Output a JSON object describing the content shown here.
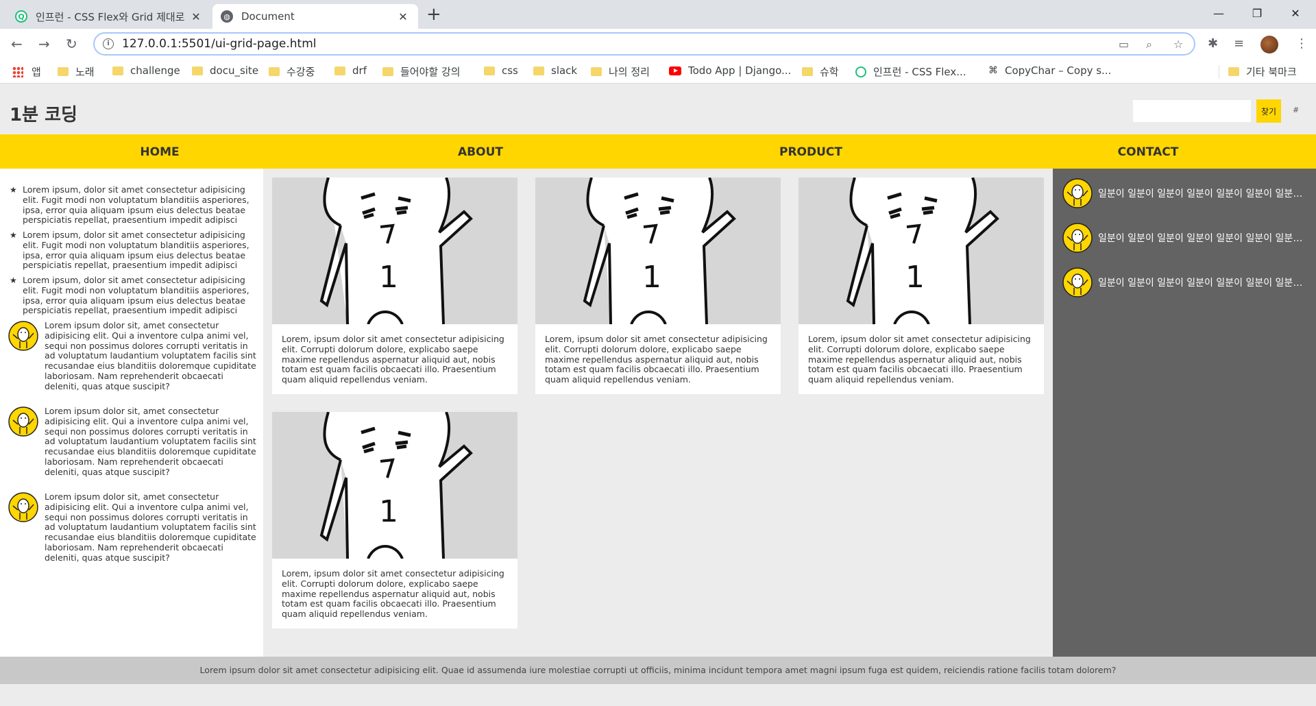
{
  "browser": {
    "tabs": [
      {
        "title": "인프런 - CSS Flex와 Grid 제대로",
        "active": false
      },
      {
        "title": "Document",
        "active": true
      }
    ],
    "url": "127.0.0.1:5501/ui-grid-page.html",
    "bookmarks": [
      "앱",
      "노래",
      "challenge",
      "docu_site",
      "수강중",
      "drf",
      "들어야할 강의",
      "css",
      "slack",
      "나의 정리",
      "Todo App | Django...",
      "슈학",
      "인프런 - CSS Flex...",
      "CopyChar – Copy s...",
      "기타 북마크"
    ]
  },
  "header": {
    "logo": "1분 코딩",
    "search_button": "찾기",
    "extra_link": "#"
  },
  "nav": [
    "HOME",
    "ABOUT",
    "PRODUCT",
    "CONTACT"
  ],
  "left": {
    "star_items": [
      "Lorem ipsum, dolor sit amet consectetur adipisicing elit. Fugit modi non voluptatum blanditiis asperiores, ipsa, error quia aliquam ipsum eius delectus beatae perspiciatis repellat, praesentium impedit adipisci",
      "Lorem ipsum, dolor sit amet consectetur adipisicing elit. Fugit modi non voluptatum blanditiis asperiores, ipsa, error quia aliquam ipsum eius delectus beatae perspiciatis repellat, praesentium impedit adipisci",
      "Lorem ipsum, dolor sit amet consectetur adipisicing elit. Fugit modi non voluptatum blanditiis asperiores, ipsa, error quia aliquam ipsum eius delectus beatae perspiciatis repellat, praesentium impedit adipisci"
    ],
    "avatar_items": [
      "Lorem ipsum dolor sit, amet consectetur adipisicing elit. Qui a inventore culpa animi vel, sequi non possimus dolores corrupti veritatis in ad voluptatum laudantium voluptatem facilis sint recusandae eius blanditiis doloremque cupiditate laboriosam. Nam reprehenderit obcaecati deleniti, quas atque suscipit?",
      "Lorem ipsum dolor sit, amet consectetur adipisicing elit. Qui a inventore culpa animi vel, sequi non possimus dolores corrupti veritatis in ad voluptatum laudantium voluptatem facilis sint recusandae eius blanditiis doloremque cupiditate laboriosam. Nam reprehenderit obcaecati deleniti, quas atque suscipit?",
      "Lorem ipsum dolor sit, amet consectetur adipisicing elit. Qui a inventore culpa animi vel, sequi non possimus dolores corrupti veritatis in ad voluptatum laudantium voluptatem facilis sint recusandae eius blanditiis doloremque cupiditate laboriosam. Nam reprehenderit obcaecati deleniti, quas atque suscipit?"
    ]
  },
  "cards": [
    {
      "text": "Lorem, ipsum dolor sit amet consectetur adipisicing elit. Corrupti dolorum dolore, explicabo saepe maxime repellendus aspernatur aliquid aut, nobis totam est quam facilis obcaecati illo. Praesentium quam aliquid repellendus veniam."
    },
    {
      "text": "Lorem, ipsum dolor sit amet consectetur adipisicing elit. Corrupti dolorum dolore, explicabo saepe maxime repellendus aspernatur aliquid aut, nobis totam est quam facilis obcaecati illo. Praesentium quam aliquid repellendus veniam."
    },
    {
      "text": "Lorem, ipsum dolor sit amet consectetur adipisicing elit. Corrupti dolorum dolore, explicabo saepe maxime repellendus aspernatur aliquid aut, nobis totam est quam facilis obcaecati illo. Praesentium quam aliquid repellendus veniam."
    },
    {
      "text": "Lorem, ipsum dolor sit amet consectetur adipisicing elit. Corrupti dolorum dolore, explicabo saepe maxime repellendus aspernatur aliquid aut, nobis totam est quam facilis obcaecati illo. Praesentium quam aliquid repellendus veniam."
    }
  ],
  "card_image_label": "1",
  "right": {
    "items": [
      "일분이 일분이 일분이 일분이 일분이 일분이 일분이 일분이",
      "일분이 일분이 일분이 일분이 일분이 일분이 일분이 일분이",
      "일분이 일분이 일분이 일분이 일분이 일분이 일분이 일분이"
    ]
  },
  "footer": {
    "text": "Lorem ipsum dolor sit amet consectetur adipisicing elit. Quae id assumenda iure molestiae corrupti ut officiis, minima incidunt tempora amet magni ipsum fuga est quidem, reiciendis ratione facilis totam dolorem?"
  },
  "colors": {
    "accent": "#ffd600",
    "right_panel": "#636363",
    "footer": "#c8c8c8",
    "page_bg": "#ececec"
  }
}
